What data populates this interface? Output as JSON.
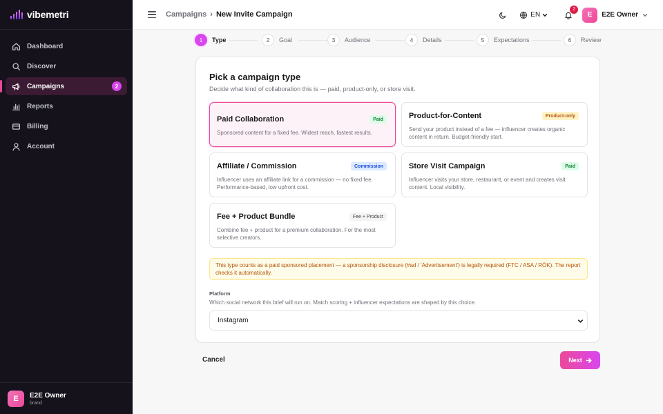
{
  "app": {
    "name": "vibemetri"
  },
  "sidebar": {
    "items": [
      {
        "label": "Dashboard",
        "icon": "home-icon"
      },
      {
        "label": "Discover",
        "icon": "search-icon"
      },
      {
        "label": "Campaigns",
        "icon": "megaphone-icon",
        "badge": "2",
        "active": true
      },
      {
        "label": "Reports",
        "icon": "bar-chart-icon"
      },
      {
        "label": "Billing",
        "icon": "credit-card-icon"
      },
      {
        "label": "Account",
        "icon": "user-icon"
      }
    ],
    "user": {
      "initial": "E",
      "name": "E2E Owner",
      "role": "brand"
    }
  },
  "header": {
    "breadcrumb": {
      "parent": "Campaigns",
      "separator": "›",
      "current": "New Invite Campaign"
    },
    "language": "EN",
    "notifications_count": "2",
    "user": {
      "initial": "E",
      "name": "E2E Owner"
    }
  },
  "stepper": {
    "steps": [
      {
        "num": "1",
        "label": "Type",
        "active": true
      },
      {
        "num": "2",
        "label": "Goal"
      },
      {
        "num": "3",
        "label": "Audience"
      },
      {
        "num": "4",
        "label": "Details"
      },
      {
        "num": "5",
        "label": "Expectations"
      },
      {
        "num": "6",
        "label": "Review"
      }
    ]
  },
  "card": {
    "title": "Pick a campaign type",
    "subtitle": "Decide what kind of collaboration this is — paid, product-only, or store visit.",
    "options": [
      {
        "title": "Paid Collaboration",
        "tag": "Paid",
        "desc": "Sponsored content for a fixed fee. Widest reach, fastest results.",
        "selected": true
      },
      {
        "title": "Product-for-Content",
        "tag": "Product-only",
        "desc": "Send your product instead of a fee — influencer creates organic content in return. Budget-friendly start."
      },
      {
        "title": "Affiliate / Commission",
        "tag": "Commission",
        "desc": "Influencer uses an affiliate link for a commission — no fixed fee. Performance-based, low upfront cost."
      },
      {
        "title": "Store Visit Campaign",
        "tag": "Paid",
        "desc": "Influencer visits your store, restaurant, or event and creates visit content. Local visibility."
      },
      {
        "title": "Fee + Product Bundle",
        "tag": "Fee + Product",
        "desc": "Combine fee + product for a premium collaboration. For the most selective creators."
      }
    ],
    "notice": "This type counts as a paid sponsored placement — a sponsorship disclosure (#ad / 'Advertisement') is legally required (FTC / ASA / RÖK). The report checks it automatically.",
    "platform": {
      "label": "Platform",
      "help": "Which social network this brief will run on. Match scoring + influencer expectations are shaped by this choice.",
      "selected": "Instagram"
    }
  },
  "actions": {
    "cancel": "Cancel",
    "next": "Next"
  },
  "colors": {
    "accent": "#d946ef",
    "brand_pink": "#ec4899",
    "sidebar_bg": "#15121b"
  }
}
